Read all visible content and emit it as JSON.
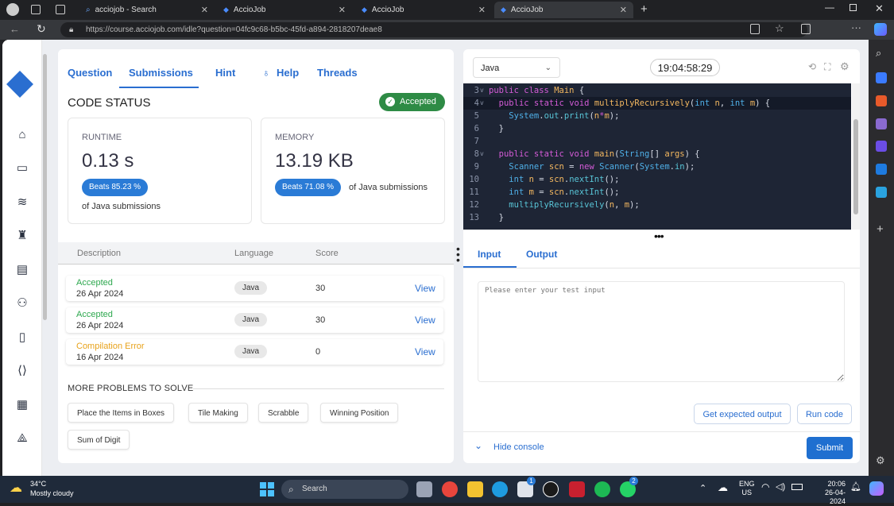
{
  "browser": {
    "tabs": [
      {
        "title": "acciojob - Search",
        "icon": "search-icon"
      },
      {
        "title": "AccioJob",
        "icon": "acciojob-logo"
      },
      {
        "title": "AccioJob",
        "icon": "acciojob-logo"
      },
      {
        "title": "AccioJob",
        "icon": "acciojob-logo",
        "active": true
      }
    ],
    "url": "https://course.acciojob.com/idle?question=04fc9c68-b5bc-45fd-a894-2818207deae8"
  },
  "problem_tabs": [
    "Question",
    "Submissions",
    "Hint",
    "Help",
    "Threads"
  ],
  "active_tab": "Submissions",
  "code_status": {
    "title": "CODE STATUS",
    "badge": "Accepted",
    "runtime": {
      "label": "RUNTIME",
      "value": "0.13 s",
      "beats": "Beats 85.23 %",
      "suffix": "of Java submissions"
    },
    "memory": {
      "label": "MEMORY",
      "value": "13.19 KB",
      "beats": "Beats 71.08 %",
      "suffix": "of Java submissions"
    }
  },
  "submissions": {
    "headers": [
      "Description",
      "Language",
      "Score"
    ],
    "rows": [
      {
        "status": "Accepted",
        "date": "26 Apr 2024",
        "language": "Java",
        "score": "30",
        "action": "View",
        "color": "#2ea84f"
      },
      {
        "status": "Accepted",
        "date": "26 Apr 2024",
        "language": "Java",
        "score": "30",
        "action": "View",
        "color": "#2ea84f"
      },
      {
        "status": "Compilation Error",
        "date": "16 Apr 2024",
        "language": "Java",
        "score": "0",
        "action": "View",
        "color": "#e8a21a"
      }
    ]
  },
  "more_problems": {
    "title": "MORE PROBLEMS TO SOLVE",
    "items": [
      "Place the Items in Boxes",
      "Tile Making",
      "Scrabble",
      "Winning Position",
      "Sum of Digit"
    ]
  },
  "editor": {
    "language": "Java",
    "timer": "19:04:58:29",
    "lines": [
      {
        "n": "3",
        "fold": "v",
        "code": "public class Main {"
      },
      {
        "n": "4",
        "fold": "v",
        "code": "  public static void multiplyRecursively(int n, int m) {"
      },
      {
        "n": "5",
        "fold": "",
        "code": "    System.out.print(n*m);"
      },
      {
        "n": "6",
        "fold": "",
        "code": "  }"
      },
      {
        "n": "7",
        "fold": "",
        "code": ""
      },
      {
        "n": "8",
        "fold": "v",
        "code": "  public static void main(String[] args) {"
      },
      {
        "n": "9",
        "fold": "",
        "code": "    Scanner scn = new Scanner(System.in);"
      },
      {
        "n": "10",
        "fold": "",
        "code": "    int n = scn.nextInt();"
      },
      {
        "n": "11",
        "fold": "",
        "code": "    int m = scn.nextInt();"
      },
      {
        "n": "12",
        "fold": "",
        "code": "    multiplyRecursively(n, m);"
      },
      {
        "n": "13",
        "fold": "",
        "code": "  }"
      }
    ]
  },
  "console": {
    "tabs": [
      "Input",
      "Output"
    ],
    "placeholder": "Please enter your test input",
    "expected_btn": "Get expected output",
    "run_btn": "Run code",
    "hide": "Hide console",
    "submit": "Submit"
  },
  "taskbar": {
    "weather_temp": "34°C",
    "weather_desc": "Mostly cloudy",
    "search": "Search",
    "lang": "ENG",
    "region": "US",
    "time": "20:06",
    "date": "26-04-2024",
    "badge_store": "1",
    "badge_whatsapp": "2"
  },
  "colors": {
    "accent": "#2a6ed0",
    "success": "#2ea84f",
    "warning": "#e8a21a",
    "editor_bg": "#1e2535"
  }
}
